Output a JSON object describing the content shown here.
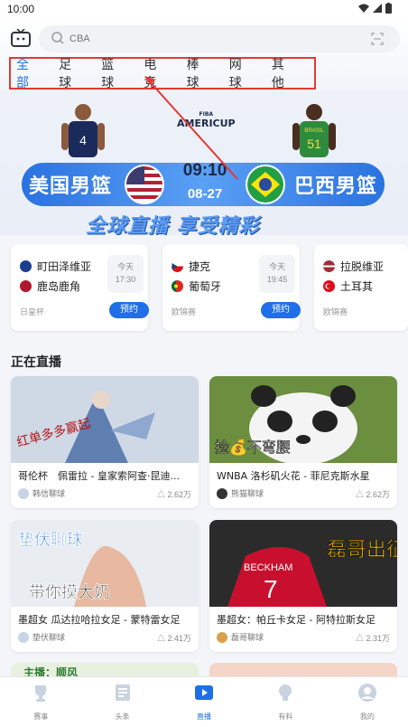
{
  "status_bar": {
    "time": "10:00"
  },
  "search": {
    "placeholder": "CBA"
  },
  "tabs": [
    {
      "label": "全部",
      "active": true
    },
    {
      "label": "足球",
      "active": false
    },
    {
      "label": "篮球",
      "active": false
    },
    {
      "label": "电竞",
      "active": false
    },
    {
      "label": "棒球",
      "active": false
    },
    {
      "label": "网球",
      "active": false
    },
    {
      "label": "其他",
      "active": false
    }
  ],
  "banner": {
    "logo_line1": "FIBA",
    "logo_line2": "AMERICUP",
    "team_left": "美国男篮",
    "team_right": "巴西男篮",
    "time": "09:10",
    "date": "08-27",
    "slogan": "全球直播 享受精彩",
    "player_left_number": "4",
    "player_right_number": "51",
    "player_right_jersey": "BRASIL"
  },
  "matches": [
    {
      "home": "町田泽维亚",
      "away": "鹿岛鹿角",
      "day": "今天",
      "time": "17:30",
      "league": "日皇杯",
      "button": "预约"
    },
    {
      "home": "捷克",
      "away": "葡萄牙",
      "day": "今天",
      "time": "19:45",
      "league": "欧锦赛",
      "button": "预约"
    },
    {
      "home": "拉脱维亚",
      "away": "土耳其",
      "league": "欧锦赛"
    }
  ],
  "live_section_title": "正在直播",
  "live_streams": [
    {
      "title": "哥伦杯　佩雷拉 - 皇家索阿查·昆迪...",
      "author": "韩信聊球",
      "views": "2.62万",
      "thumb_text": "红单多多赢起"
    },
    {
      "title": "WNBA 洛杉矶火花 - 菲尼克斯水星",
      "author": "熊猫聊球",
      "views": "2.62万",
      "thumb_text": "捡💰不弯腰"
    },
    {
      "title": "墨超女 瓜达拉哈拉女足 - 蒙特雷女足",
      "author": "垫伏聊球",
      "views": "2.41万",
      "thumb_text": "垫伏聊球"
    },
    {
      "title": "墨超女：帕丘卡女足 - 阿特拉斯女足",
      "author": "磊哥聊球",
      "views": "2.31万",
      "thumb_text": "磊哥出征"
    }
  ],
  "partial_cards": [
    {
      "text": "主播：顺风"
    }
  ],
  "thumb_extra": {
    "handwriting_top": "带你摸大奶",
    "jersey_name": "BECKHAM",
    "jersey_number": "7"
  },
  "bottom_nav": [
    {
      "label": "赛事",
      "active": false
    },
    {
      "label": "头条",
      "active": false
    },
    {
      "label": "直播",
      "active": true
    },
    {
      "label": "有料",
      "active": false
    },
    {
      "label": "我的",
      "active": false
    }
  ],
  "colors": {
    "accent": "#1e6fe8",
    "highlight_box": "#e53935"
  }
}
